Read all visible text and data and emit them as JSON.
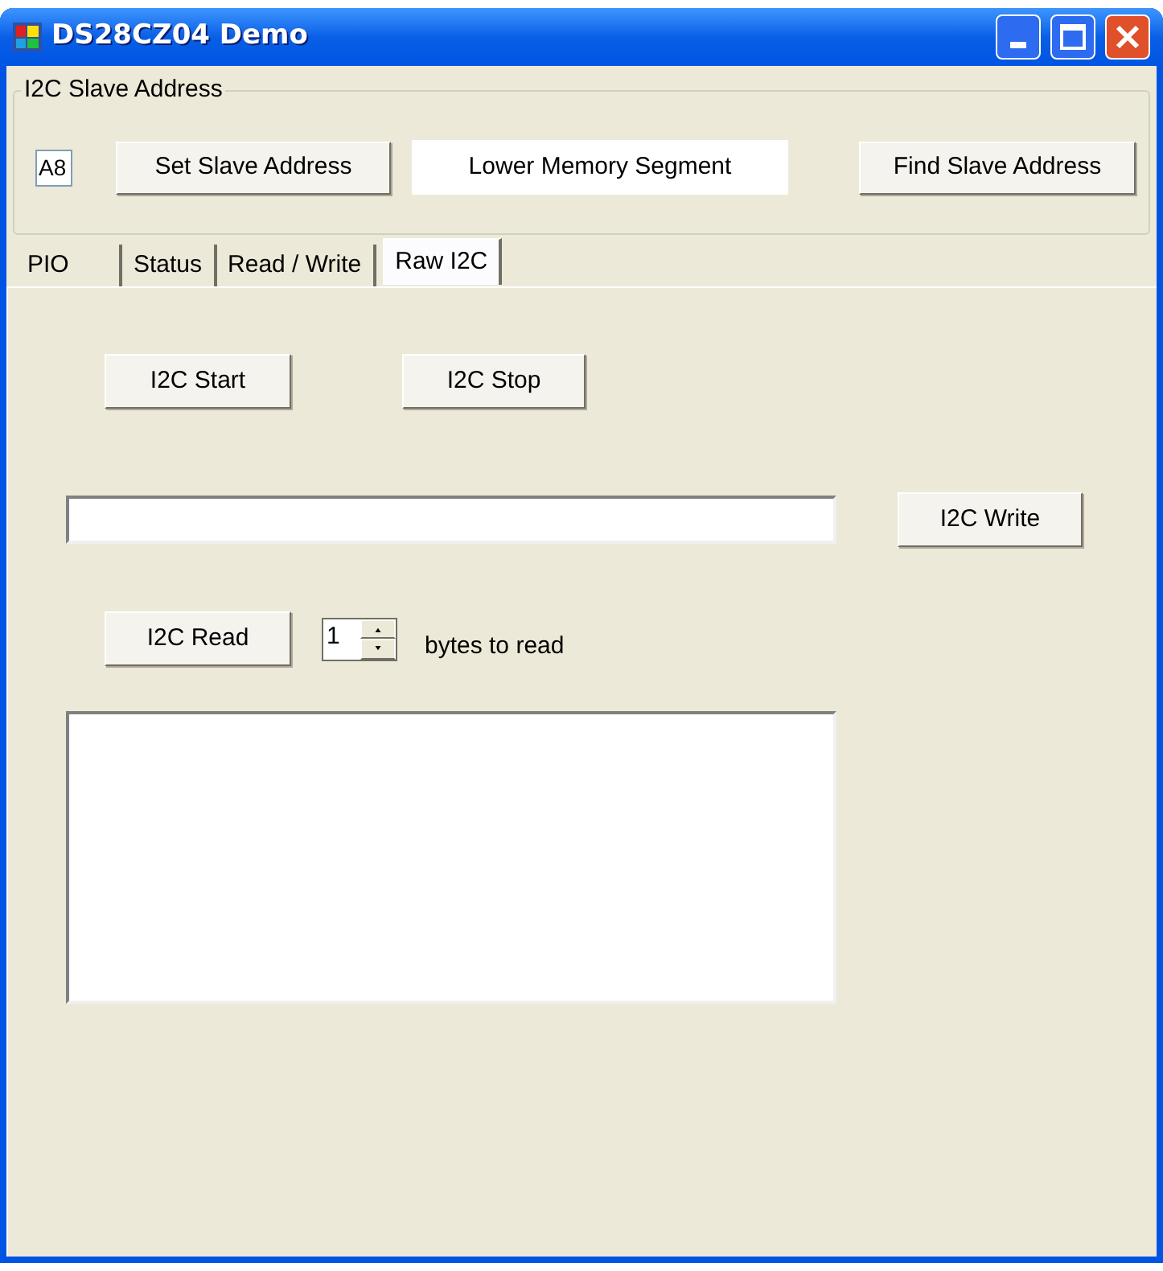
{
  "window": {
    "title": "DS28CZ04 Demo"
  },
  "slave_address": {
    "group_label": "I2C Slave Address",
    "address_value": "A8",
    "set_button": "Set Slave Address",
    "segment_label": "Lower Memory Segment",
    "find_button": "Find Slave Address"
  },
  "tabs": [
    {
      "label": "PIO",
      "selected": false
    },
    {
      "label": "Status",
      "selected": false
    },
    {
      "label": "Read / Write",
      "selected": false
    },
    {
      "label": "Raw I2C",
      "selected": true
    }
  ],
  "raw_i2c": {
    "start_button": "I2C Start",
    "stop_button": "I2C Stop",
    "write_button": "I2C Write",
    "read_button": "I2C Read",
    "byte_count": "1",
    "byte_count_label": "bytes to read"
  }
}
